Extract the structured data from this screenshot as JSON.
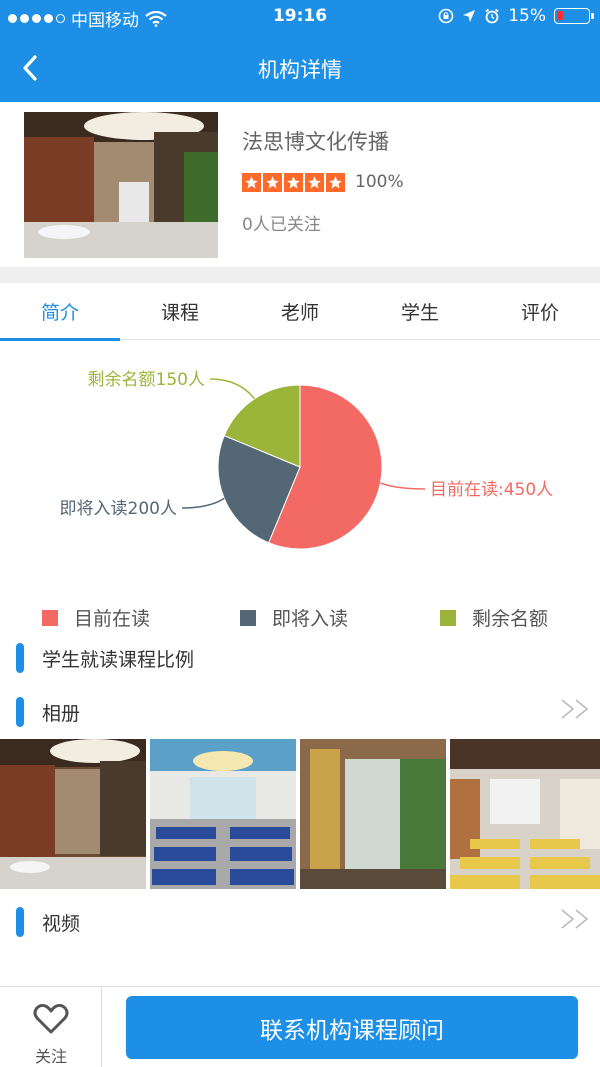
{
  "status_bar": {
    "carrier": "中国移动",
    "time": "19:16",
    "battery": "15%"
  },
  "nav": {
    "title": "机构详情"
  },
  "org": {
    "name": "法思博文化传播",
    "stars": 5,
    "rating": "100%",
    "followers": "0人已关注"
  },
  "tabs": [
    "简介",
    "课程",
    "老师",
    "学生",
    "评价"
  ],
  "active_tab": "简介",
  "chart_data": {
    "type": "pie",
    "slices": [
      {
        "label": "目前在读:450人",
        "name": "目前在读",
        "value": 450,
        "color": "#f26a63"
      },
      {
        "label": "即将入读200人",
        "name": "即将入读",
        "value": 200,
        "color": "#546775"
      },
      {
        "label": "剩余名额150人",
        "name": "剩余名额",
        "value": 150,
        "color": "#9ab53a"
      }
    ],
    "legend": [
      "目前在读",
      "即将入读",
      "剩余名额"
    ]
  },
  "sections": {
    "ratio": "学生就读课程比例",
    "album": "相册",
    "video": "视频"
  },
  "footer": {
    "follow": "关注",
    "contact": "联系机构课程顾问"
  },
  "colors": {
    "primary": "#1e8fe6",
    "star": "#ff6a2a"
  }
}
